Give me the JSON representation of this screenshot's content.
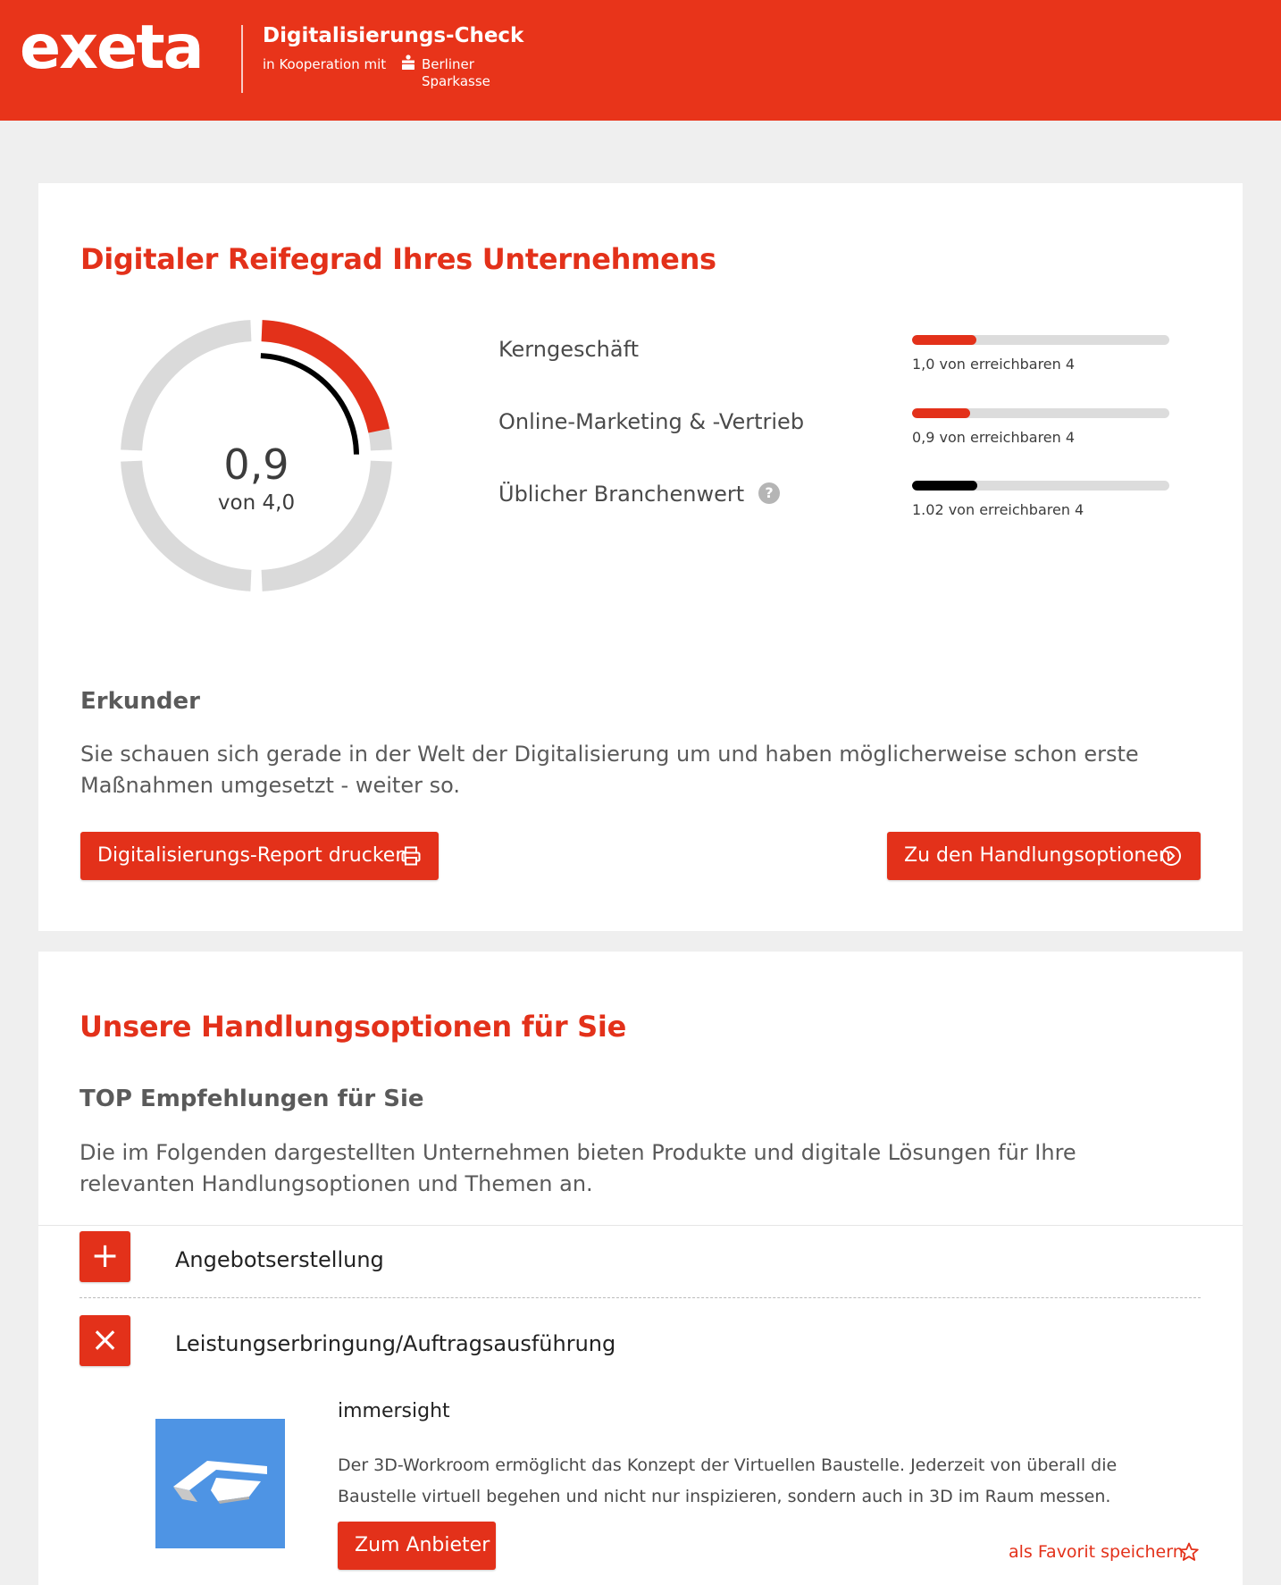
{
  "header": {
    "logo_text": "exeta",
    "brand_title": "Digitalisierungs-Check",
    "cooperation_text": "in Kooperation mit",
    "partner_name": "Berliner Sparkasse"
  },
  "maturity": {
    "title": "Digitaler Reifegrad Ihres Unternehmens",
    "score": "0,9",
    "score_max": "von 4,0",
    "score_value": 0.9,
    "max_value": 4.0,
    "benchmark_value": 1.02,
    "metrics": [
      {
        "label": "Kerngeschäft",
        "value": 1.0,
        "caption": "1,0 von erreichbaren 4",
        "color": "#e3311a"
      },
      {
        "label": "Online-Marketing & -Vertrieb",
        "value": 0.9,
        "caption": "0,9 von erreichbaren 4",
        "color": "#e3311a"
      },
      {
        "label": "Üblicher Branchenwert",
        "value": 1.02,
        "caption": "1.02  von erreichbaren 4",
        "color": "#000000"
      }
    ],
    "level_title": "Erkunder",
    "level_text": "Sie schauen sich gerade in der Welt der Digitalisierung um und haben möglicherweise schon erste Maßnahmen umgesetzt - weiter so.",
    "print_button": "Digitalisierungs-Report drucken",
    "options_button": "Zu den Handlungsoptionen"
  },
  "options": {
    "title": "Unsere Handlungsoptionen für Sie",
    "top_title": "TOP Empfehlungen für Sie",
    "top_text": "Die im Folgenden dargestellten Unternehmen bieten Produkte und digitale Lösungen für Ihre relevanten Handlungsoptionen und Themen an.",
    "accordion": [
      {
        "label": "Angebotserstellung",
        "toggle": "+",
        "state": "collapsed"
      },
      {
        "label": "Leistungserbringung/Auftragsausführung",
        "toggle": "×",
        "state": "expanded"
      }
    ],
    "provider": {
      "name": "immersight",
      "description": "Der 3D-Workroom ermöglicht das Konzept der Virtuellen Baustelle. Jederzeit von überall die Baustelle virtuell begehen und nicht nur inspizieren, sondern auch in 3D im Raum messen.",
      "button": "Zum Anbieter",
      "favorite": "als Favorit speichern"
    }
  },
  "colors": {
    "brand_red": "#e8341a",
    "accent_red": "#e3311a",
    "benchmark": "#000000",
    "track": "#dcdcdc",
    "provider_logo_bg": "#4e94e4"
  },
  "icons": [
    "sparkasse-icon",
    "help-icon",
    "printer-icon",
    "arrow-circle-right-icon",
    "plus-icon",
    "close-icon",
    "immersight-logo",
    "star-icon"
  ]
}
